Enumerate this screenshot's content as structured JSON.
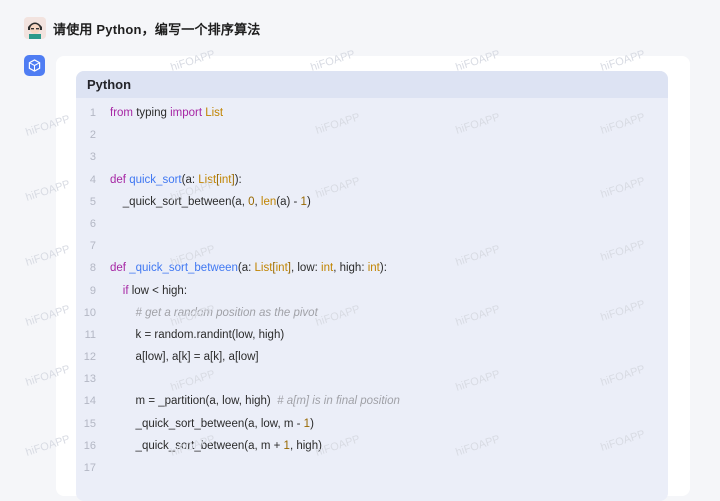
{
  "user": {
    "prompt": "请使用 Python，编写一个排序算法"
  },
  "code_block": {
    "language": "Python",
    "lines": [
      {
        "n": "1",
        "tokens": [
          {
            "t": "from",
            "c": "kw"
          },
          {
            "t": " typing ",
            "c": ""
          },
          {
            "t": "import",
            "c": "kw"
          },
          {
            "t": " List",
            "c": "ty"
          }
        ]
      },
      {
        "n": "2",
        "tokens": []
      },
      {
        "n": "3",
        "tokens": []
      },
      {
        "n": "4",
        "tokens": [
          {
            "t": "def",
            "c": "kw"
          },
          {
            "t": " ",
            "c": ""
          },
          {
            "t": "quick_sort",
            "c": "fn"
          },
          {
            "t": "(a: ",
            "c": ""
          },
          {
            "t": "List",
            "c": "ty"
          },
          {
            "t": "[",
            "c": "nm"
          },
          {
            "t": "int",
            "c": "bi"
          },
          {
            "t": "]",
            "c": "nm"
          },
          {
            "t": "):",
            "c": ""
          }
        ]
      },
      {
        "n": "5",
        "tokens": [
          {
            "t": "    _quick_sort_between(a, ",
            "c": ""
          },
          {
            "t": "0",
            "c": "nm"
          },
          {
            "t": ", ",
            "c": ""
          },
          {
            "t": "len",
            "c": "bi"
          },
          {
            "t": "(a) - ",
            "c": ""
          },
          {
            "t": "1",
            "c": "nm"
          },
          {
            "t": ")",
            "c": ""
          }
        ]
      },
      {
        "n": "6",
        "tokens": []
      },
      {
        "n": "7",
        "tokens": []
      },
      {
        "n": "8",
        "tokens": [
          {
            "t": "def",
            "c": "kw"
          },
          {
            "t": " ",
            "c": ""
          },
          {
            "t": "_quick_sort_between",
            "c": "fn"
          },
          {
            "t": "(a: ",
            "c": ""
          },
          {
            "t": "List",
            "c": "ty"
          },
          {
            "t": "[",
            "c": "nm"
          },
          {
            "t": "int",
            "c": "bi"
          },
          {
            "t": "]",
            "c": "nm"
          },
          {
            "t": ", low: ",
            "c": ""
          },
          {
            "t": "int",
            "c": "bi"
          },
          {
            "t": ", high: ",
            "c": ""
          },
          {
            "t": "int",
            "c": "bi"
          },
          {
            "t": "):",
            "c": ""
          }
        ]
      },
      {
        "n": "9",
        "tokens": [
          {
            "t": "    ",
            "c": ""
          },
          {
            "t": "if",
            "c": "kw"
          },
          {
            "t": " low < high:",
            "c": ""
          }
        ]
      },
      {
        "n": "10",
        "tokens": [
          {
            "t": "        # get a random position as the pivot",
            "c": "cm"
          }
        ]
      },
      {
        "n": "11",
        "tokens": [
          {
            "t": "        k = random.randint(low, high)",
            "c": ""
          }
        ]
      },
      {
        "n": "12",
        "tokens": [
          {
            "t": "        a[low], a[k] = a[k], a[low]",
            "c": ""
          }
        ]
      },
      {
        "n": "13",
        "tokens": []
      },
      {
        "n": "14",
        "tokens": [
          {
            "t": "        m = _partition(a, low, high)  ",
            "c": ""
          },
          {
            "t": "# a[m] is in final position",
            "c": "cm"
          }
        ]
      },
      {
        "n": "15",
        "tokens": [
          {
            "t": "        _quick_sort_between(a, low, m - ",
            "c": ""
          },
          {
            "t": "1",
            "c": "nm"
          },
          {
            "t": ")",
            "c": ""
          }
        ]
      },
      {
        "n": "16",
        "tokens": [
          {
            "t": "        _quick_sort_between(a, m + ",
            "c": ""
          },
          {
            "t": "1",
            "c": "nm"
          },
          {
            "t": ", high)",
            "c": ""
          }
        ]
      },
      {
        "n": "17",
        "tokens": []
      }
    ]
  },
  "watermark": "hiFOAPP",
  "colors": {
    "keyword": "#a626a4",
    "function": "#4078f2",
    "type": "#c18401",
    "number": "#986801",
    "comment": "#a0a1a7",
    "bot_icon": "#4f7df3"
  },
  "icons": {
    "user_avatar": "avatar-icon",
    "bot": "assistant-cube-icon"
  }
}
